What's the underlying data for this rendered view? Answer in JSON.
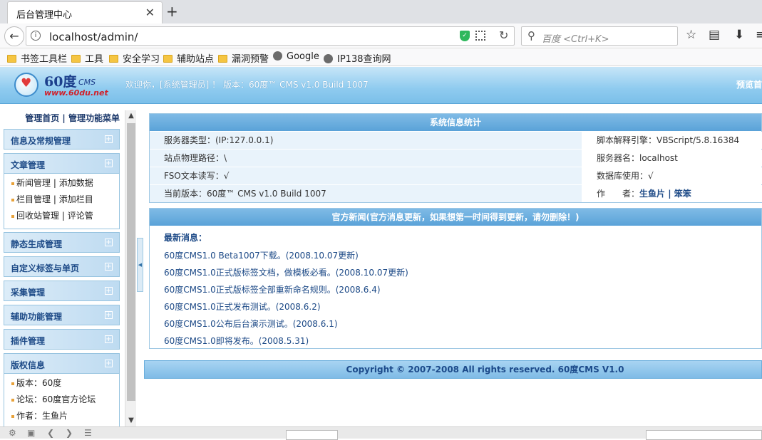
{
  "browser": {
    "tab_title": "后台管理中心",
    "url": "localhost/admin/",
    "search_placeholder": "百度 <Ctrl+K>",
    "bookmarks": [
      {
        "label": "书签工具栏",
        "icon": "folder-icon"
      },
      {
        "label": "工具",
        "icon": "folder-icon"
      },
      {
        "label": "安全学习",
        "icon": "folder-icon"
      },
      {
        "label": "辅助站点",
        "icon": "folder-icon"
      },
      {
        "label": "漏洞预警",
        "icon": "folder-icon"
      },
      {
        "label": "Google",
        "icon": "globe-icon"
      },
      {
        "label": "IP138查询网",
        "icon": "globe-icon"
      }
    ]
  },
  "header": {
    "logo_name": "60度",
    "logo_cms": "CMS",
    "logo_url": "www.60du.net",
    "welcome_prefix": "欢迎你，[系统管理员] ！ 版本：",
    "welcome_version": "60度™ CMS v1.0 Build 1007",
    "preview_link": "预览首页"
  },
  "sidebar": {
    "top_links": "管理首页 | 管理功能菜单",
    "menus": [
      {
        "title": "信息及常规管理"
      },
      {
        "title": "文章管理"
      },
      {
        "title": "静态生成管理"
      },
      {
        "title": "自定义标签与单页"
      },
      {
        "title": "采集管理"
      },
      {
        "title": "辅助功能管理"
      },
      {
        "title": "插件管理"
      },
      {
        "title": "版权信息"
      }
    ],
    "article_items": [
      {
        "a": "新闻管理",
        "b": "添加数据"
      },
      {
        "a": "栏目管理",
        "b": "添加栏目"
      },
      {
        "a": "回收站管理",
        "b": "评论管"
      }
    ],
    "copyright_items": [
      {
        "text": "版本：60度"
      },
      {
        "text": "论坛：60度官方论坛"
      },
      {
        "text": "作者：生鱼片"
      }
    ]
  },
  "sysinfo": {
    "title": "系统信息统计",
    "rows": [
      {
        "left": "服务器类型：(IP:127.0.0.1)",
        "right": "脚本解释引擎：VBScript/5.8.16384"
      },
      {
        "left": "站点物理路径：\\",
        "right": "服务器名：localhost"
      },
      {
        "left": "FSO文本读写：√",
        "right": "数据库使用：√"
      },
      {
        "left": "当前版本：60度™ CMS v1.0 Build 1007",
        "right_label": "作　　者：",
        "right_author": "生鱼片 | 笨笨"
      }
    ]
  },
  "news": {
    "title": "官方新闻(官方消息更新，如果想第一时间得到更新，请勿删除！)",
    "latest_label": "最新消息：",
    "items": [
      "60度CMS1.0 Beta1007下载。(2008.10.07更新)",
      "60度CMS1.0正式版标签文档，做模板必看。(2008.10.07更新)",
      "60度CMS1.0正式版标签全部重新命名规则。(2008.6.4)",
      "60度CMS1.0正式发布测试。(2008.6.2)",
      "60度CMS1.0公布后台演示测试。(2008.6.1)",
      "60度CMS1.0即将发布。(2008.5.31)"
    ]
  },
  "footer": {
    "copyright": "Copyright © 2007-2008 All rights reserved. 60度CMS V1.0"
  },
  "colors": {
    "header_blue": "#8fcbef",
    "panel_head": "#5aa2d8",
    "link_blue": "#1d4a87"
  }
}
